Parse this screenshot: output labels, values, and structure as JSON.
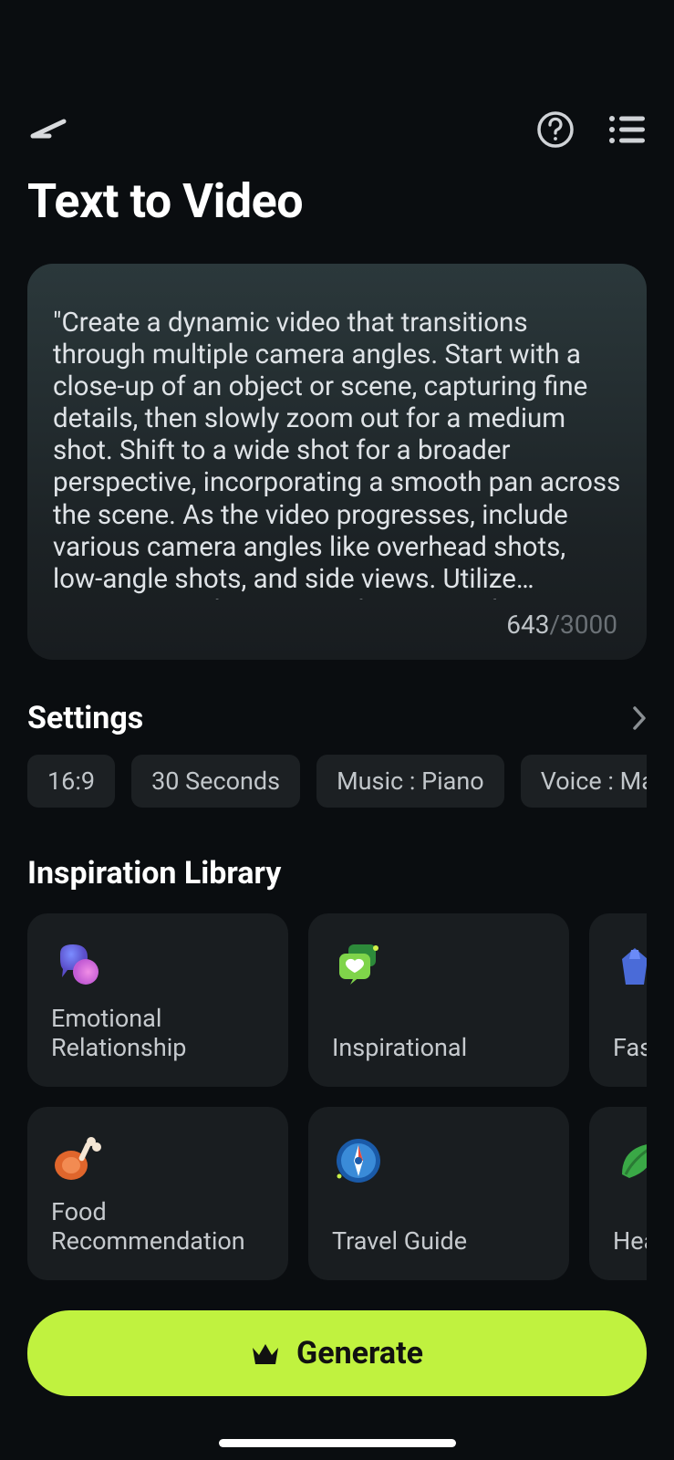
{
  "header": {
    "title": "Text to Video"
  },
  "prompt": {
    "text": "\"Create a dynamic video that transitions through multiple camera angles. Start with a close-up of an object or scene, capturing fine details, then slowly zoom out for a medium shot. Shift to a wide shot for a broader perspective, incorporating a smooth pan across the scene. As the video progresses, include various camera angles like overhead shots, low-angle shots, and side views. Utilize cinematic techniques such as smooth transitions, slow-motion",
    "count": "643",
    "max": "/3000"
  },
  "settings": {
    "title": "Settings",
    "chips": {
      "ratio": "16:9",
      "duration": "30 Seconds",
      "music": "Music : Piano",
      "voice": "Voice : Marcus"
    }
  },
  "library": {
    "title": "Inspiration Library",
    "cards": {
      "emotional": "Emotional Relationship",
      "inspirational": "Inspirational",
      "fashion": "Fash",
      "food": "Food Recommendation",
      "travel": "Travel Guide",
      "health": "Heal"
    }
  },
  "generate": {
    "label": "Generate"
  }
}
